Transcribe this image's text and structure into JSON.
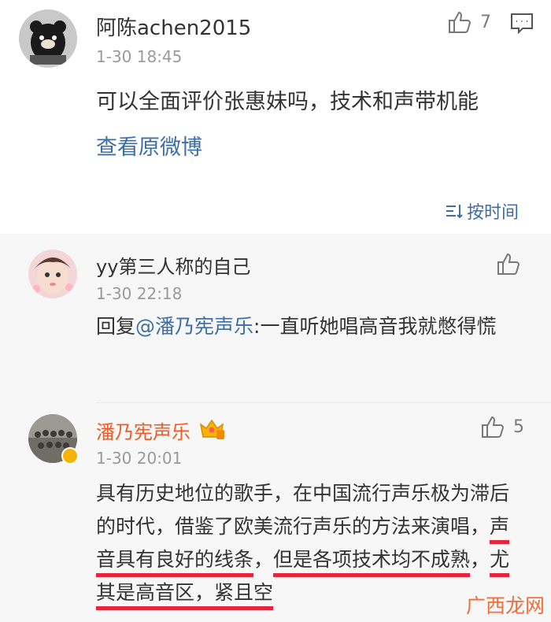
{
  "main_post": {
    "user": "阿陈achen2015",
    "time": "1-30 18:45",
    "likes": "7",
    "text": "可以全面评价张惠妹吗，技术和声带机能",
    "view_original": "查看原微博",
    "sort_label": "按时间"
  },
  "replies": [
    {
      "user": "yy第三人称的自己",
      "time": "1-30 22:18",
      "reply_prefix": "回复",
      "mention": "@潘乃宪声乐",
      "text": ":一直听她唱高音我就憋得慌"
    },
    {
      "user": "潘乃宪声乐",
      "time": "1-30 20:01",
      "likes": "5",
      "text_1": "具有历史地位的歌手，在中国流行声乐极为滞后的时代，借鉴了欧美流行声乐的方法来演唱，",
      "highlight_1": "声音具有良好的线条",
      "text_2": "，",
      "highlight_2": "但是各项技术均不成熟",
      "text_3": "，",
      "highlight_3": "尤其是高音区，紧且空"
    }
  ],
  "watermark": "广西龙网",
  "colors": {
    "link": "#3c6ea3",
    "vip_name": "#f15a22",
    "underline": "#e3263c"
  }
}
